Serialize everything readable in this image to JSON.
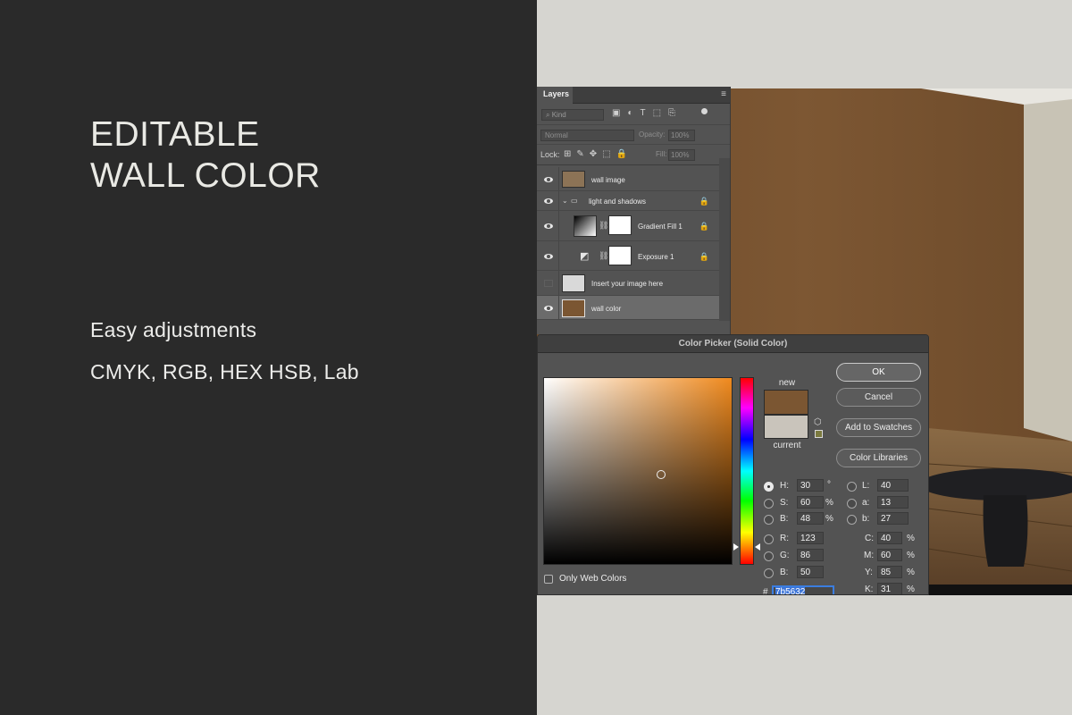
{
  "promo": {
    "headline_line1": "EDITABLE",
    "headline_line2": "WALL COLOR",
    "feature_1": "Easy adjustments",
    "feature_2": "CMYK, RGB, HEX HSB, Lab"
  },
  "layers_panel": {
    "tab": "Layers",
    "kind_placeholder": "Kind",
    "blend_mode": "Normal",
    "opacity_label": "Opacity:",
    "opacity_value": "100%",
    "lock_label": "Lock:",
    "fill_label": "Fill:",
    "fill_value": "100%",
    "layers": [
      {
        "name": "wall image"
      },
      {
        "name": "light and shadows"
      },
      {
        "name": "Gradient Fill 1"
      },
      {
        "name": "Exposure 1"
      },
      {
        "name": "Insert your image here"
      },
      {
        "name": "wall color"
      }
    ]
  },
  "color_picker": {
    "title": "Color Picker (Solid Color)",
    "new_label": "new",
    "current_label": "current",
    "new_color": "#7b5632",
    "current_color": "#c9c4bb",
    "buttons": {
      "ok": "OK",
      "cancel": "Cancel",
      "add_to_swatches": "Add to Swatches",
      "color_libraries": "Color Libraries"
    },
    "only_web_colors": "Only Web Colors",
    "hsb": {
      "h_label": "H:",
      "h": "30",
      "h_unit": "°",
      "s_label": "S:",
      "s": "60",
      "s_unit": "%",
      "b_label": "B:",
      "b": "48",
      "b_unit": "%"
    },
    "rgb": {
      "r_label": "R:",
      "r": "123",
      "g_label": "G:",
      "g": "86",
      "b_label": "B:",
      "b": "50"
    },
    "lab": {
      "l_label": "L:",
      "l": "40",
      "a_label": "a:",
      "a": "13",
      "b_label": "b:",
      "b": "27"
    },
    "cmyk": {
      "c_label": "C:",
      "c": "40",
      "m_label": "M:",
      "m": "60",
      "y_label": "Y:",
      "y": "85",
      "k_label": "K:",
      "k": "31",
      "unit": "%"
    },
    "hex_label": "#",
    "hex": "7b5632"
  },
  "colors": {
    "left_panel_bg": "#2a2a2a",
    "right_bg": "#d6d5d0",
    "wall": "#7b5632"
  }
}
